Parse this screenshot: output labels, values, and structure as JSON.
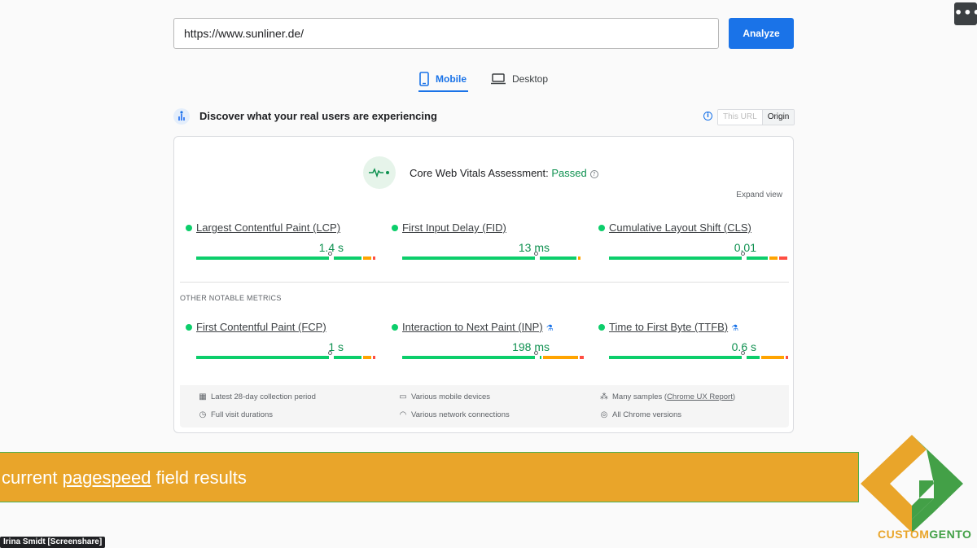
{
  "search": {
    "url": "https://www.sunliner.de/",
    "button_label": "Analyze"
  },
  "menu": {
    "more_label": "•••"
  },
  "tabs": [
    {
      "label": "Mobile",
      "active": true
    },
    {
      "label": "Desktop",
      "active": false
    }
  ],
  "discover": {
    "title": "Discover what your real users are experiencing",
    "toggle": {
      "this_url": "This URL",
      "origin": "Origin",
      "selected": "Origin"
    }
  },
  "assessment": {
    "label": "Core Web Vitals Assessment: ",
    "status": "Passed",
    "expand_label": "Expand view"
  },
  "core_metrics": [
    {
      "label": "Largest Contentful Paint (LCP)",
      "value": "1.4 s",
      "status_color": "#0cce6b"
    },
    {
      "label": "First Input Delay (FID)",
      "value": "13 ms",
      "status_color": "#0cce6b"
    },
    {
      "label": "Cumulative Layout Shift (CLS)",
      "value": "0.01",
      "status_color": "#0cce6b"
    }
  ],
  "other_title": "OTHER NOTABLE METRICS",
  "other_metrics": [
    {
      "label": "First Contentful Paint (FCP)",
      "value": "1 s",
      "experimental": false
    },
    {
      "label": "Interaction to Next Paint (INP)",
      "value": "198 ms",
      "experimental": true
    },
    {
      "label": "Time to First Byte (TTFB)",
      "value": "0.6 s",
      "experimental": true
    }
  ],
  "footer": {
    "items": [
      {
        "icon": "calendar-icon",
        "text": "Latest 28-day collection period"
      },
      {
        "icon": "devices-icon",
        "text": "Various mobile devices"
      },
      {
        "icon": "samples-icon",
        "text_before": "Many samples (",
        "link": "Chrome UX Report",
        "text_after": ")"
      },
      {
        "icon": "timer-icon",
        "text": "Full visit durations"
      },
      {
        "icon": "wifi-icon",
        "text": "Various network connections"
      },
      {
        "icon": "chrome-icon",
        "text": "All Chrome versions"
      }
    ]
  },
  "banner": {
    "text_before": "current ",
    "link_word": "pagespeed",
    "text_after": " field results"
  },
  "presenter": {
    "label": "Irina Smidt [Screenshare]"
  },
  "logo": {
    "part1": "CUSTOM",
    "part2": "GENTO"
  },
  "colors": {
    "accent": "#1a73e8",
    "good": "#0cce6b",
    "good_text": "#0d904f",
    "needs_improvement": "#ffa400",
    "poor": "#ff4e42",
    "banner": "#e9a52a"
  }
}
